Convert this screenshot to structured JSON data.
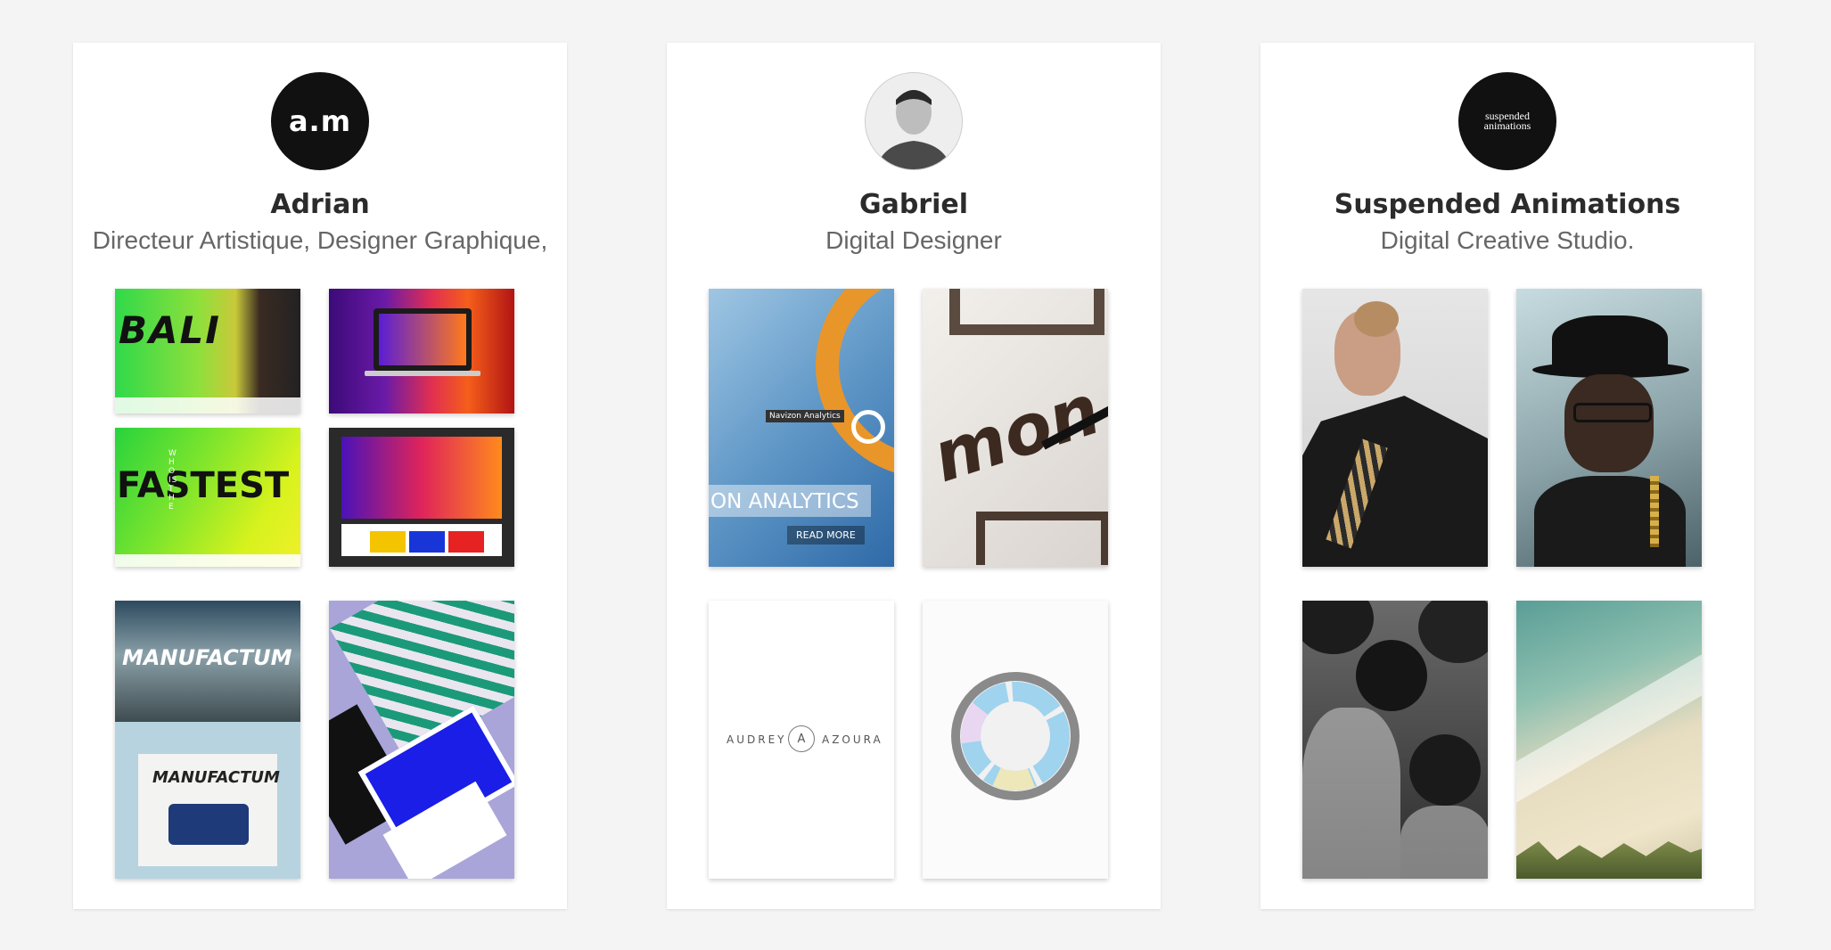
{
  "profiles": [
    {
      "avatar_text": "a.m",
      "name": "Adrian",
      "subtitle": "Directeur Artistique, Designer Graphique,"
    },
    {
      "avatar_text": "",
      "name": "Gabriel",
      "subtitle": "Digital Designer"
    },
    {
      "avatar_text": "suspended animations",
      "name": "Suspended Animations",
      "subtitle": "Digital Creative Studio."
    }
  ],
  "thumb_text": {
    "bali": "BALI",
    "fastest": "FASTEST",
    "who": "WHO IS THE",
    "manufactum": "MANUFACTUM",
    "manufactum_small": "MANUFACTUM",
    "navizon_tag": "Navizon Analytics",
    "analytics": "ON ANALYTICS",
    "read_more": "READ MORE",
    "mon": "mon",
    "audrey_left": "AUDREY",
    "audrey_right": "AZOURA",
    "audrey_mark": "A"
  }
}
